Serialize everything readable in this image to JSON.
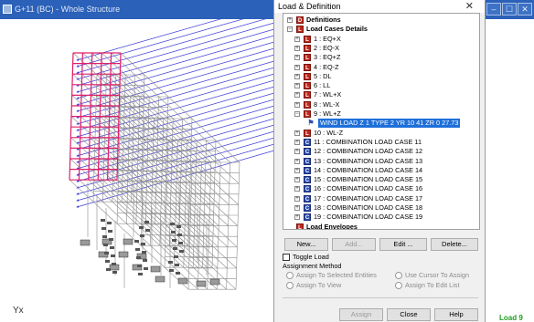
{
  "window": {
    "title": "G+11 (BC) - Whole Structure",
    "buttons": [
      "–",
      "☐",
      "✕"
    ]
  },
  "view": {
    "axis_label": "Yx",
    "status_badge": "Load 9"
  },
  "dialog": {
    "title": "Load & Definition",
    "close_glyph": "✕",
    "tree": [
      {
        "label": "Definitions",
        "icon": "D",
        "bold": true,
        "expander": "+",
        "level": 0
      },
      {
        "label": "Load Cases Details",
        "icon": "L",
        "bold": true,
        "expander": "−",
        "level": 0
      },
      {
        "label": "1 : EQ+X",
        "icon": "L",
        "expander": "+",
        "level": 1
      },
      {
        "label": "2 : EQ-X",
        "icon": "L",
        "expander": "+",
        "level": 1
      },
      {
        "label": "3 : EQ+Z",
        "icon": "L",
        "expander": "+",
        "level": 1
      },
      {
        "label": "4 : EQ-Z",
        "icon": "L",
        "expander": "+",
        "level": 1
      },
      {
        "label": "5 : DL",
        "icon": "L",
        "expander": "+",
        "level": 1
      },
      {
        "label": "6 : LL",
        "icon": "L",
        "expander": "+",
        "level": 1
      },
      {
        "label": "7 : WL+X",
        "icon": "L",
        "expander": "+",
        "level": 1
      },
      {
        "label": "8 : WL-X",
        "icon": "L",
        "expander": "+",
        "level": 1
      },
      {
        "label": "9 : WL+Z",
        "icon": "L",
        "expander": "−",
        "level": 1
      },
      {
        "label": "WIND LOAD Z 1 TYPE 2 YR 10 41 ZR 0 27.73",
        "icon": "W",
        "selected": true,
        "level": 2
      },
      {
        "label": "10 : WL-Z",
        "icon": "L",
        "expander": "+",
        "level": 1
      },
      {
        "label": "11 : COMBINATION LOAD CASE 11",
        "icon": "C",
        "expander": "+",
        "level": 1
      },
      {
        "label": "12 : COMBINATION LOAD CASE 12",
        "icon": "C",
        "expander": "+",
        "level": 1
      },
      {
        "label": "13 : COMBINATION LOAD CASE 13",
        "icon": "C",
        "expander": "+",
        "level": 1
      },
      {
        "label": "14 : COMBINATION LOAD CASE 14",
        "icon": "C",
        "expander": "+",
        "level": 1
      },
      {
        "label": "15 : COMBINATION LOAD CASE 15",
        "icon": "C",
        "expander": "+",
        "level": 1
      },
      {
        "label": "16 : COMBINATION LOAD CASE 16",
        "icon": "C",
        "expander": "+",
        "level": 1
      },
      {
        "label": "17 : COMBINATION LOAD CASE 17",
        "icon": "C",
        "expander": "+",
        "level": 1
      },
      {
        "label": "18 : COMBINATION LOAD CASE 18",
        "icon": "C",
        "expander": "+",
        "level": 1
      },
      {
        "label": "19 : COMBINATION LOAD CASE 19",
        "icon": "C",
        "expander": "+",
        "level": 1
      },
      {
        "label": "Load Envelopes",
        "icon": "E",
        "bold": true,
        "level": 0
      }
    ],
    "buttons": {
      "new": "New...",
      "add": "Add...",
      "edit": "Edit ...",
      "delete": "Delete..."
    },
    "toggle_load": "Toggle Load",
    "assignment_method": "Assignment Method",
    "radios": {
      "selected_entities": "Assign To Selected Entities",
      "use_cursor": "Use Cursor To Assign",
      "assign_view": "Assign To View",
      "edit_list": "Assign To Edit List"
    },
    "footer": {
      "assign": "Assign",
      "close": "Close",
      "help": "Help"
    }
  },
  "colors": {
    "titlebar": "#2b61b8",
    "selection": "#1e6fd9",
    "load_arrows": "#3b3bd9",
    "highlight_members": "#e0206a",
    "status_green": "#1e9e1e"
  }
}
